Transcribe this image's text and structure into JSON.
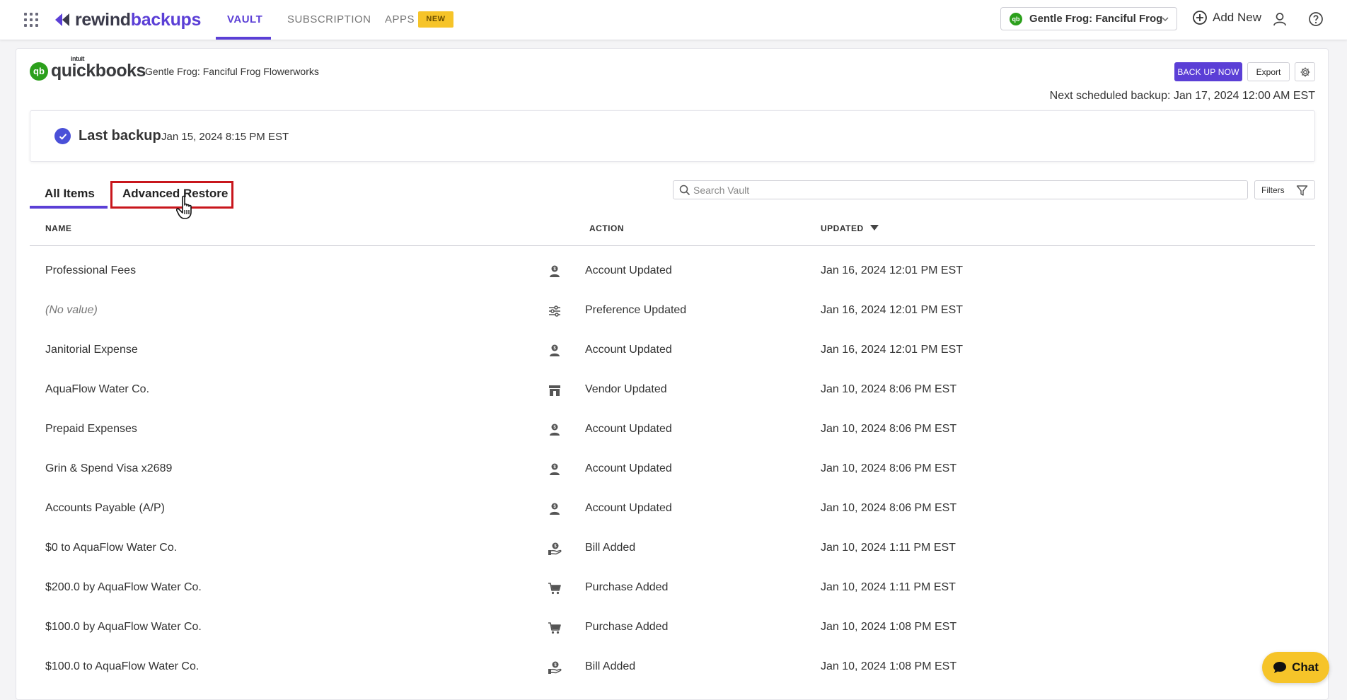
{
  "topbar": {
    "brand_part1": "rewind",
    "brand_part2": "backups",
    "nav": [
      {
        "label": "VAULT",
        "active": true
      },
      {
        "label": "SUBSCRIPTION",
        "active": false
      },
      {
        "label": "APPS",
        "active": false
      }
    ],
    "new_badge": "NEW",
    "org_selector": "Gentle Frog: Fanciful Frog F...",
    "add_new": "Add New",
    "icons": [
      "apps-grid-icon",
      "chevron-down-icon",
      "plus-circle-icon",
      "user-icon",
      "help-icon"
    ]
  },
  "header": {
    "logo_brand": "quickbooks",
    "logo_intuit": "intuit",
    "logo_mark": "qb",
    "company": "Gentle Frog: Fanciful Frog Flowerworks",
    "backup_button": "BACK UP NOW",
    "export_button": "Export",
    "next_backup": "Next scheduled backup: Jan 17, 2024 12:00 AM EST"
  },
  "last_backup": {
    "label": "Last backup",
    "date": "Jan 15, 2024 8:15 PM EST"
  },
  "tabs": {
    "all_items": "All Items",
    "advanced_restore": "Advanced Restore"
  },
  "search": {
    "placeholder": "Search Vault",
    "filters_label": "Filters"
  },
  "table": {
    "columns": {
      "name": "NAME",
      "action": "ACTION",
      "updated": "UPDATED"
    },
    "sort": "descending",
    "rows": [
      {
        "name": "Professional Fees",
        "icon": "account-icon",
        "action": "Account Updated",
        "updated": "Jan 16, 2024 12:01 PM EST"
      },
      {
        "name": "(No value)",
        "icon": "preference-icon",
        "action": "Preference Updated",
        "updated": "Jan 16, 2024 12:01 PM EST"
      },
      {
        "name": "Janitorial Expense",
        "icon": "account-icon",
        "action": "Account Updated",
        "updated": "Jan 16, 2024 12:01 PM EST"
      },
      {
        "name": "AquaFlow Water Co.",
        "icon": "vendor-icon",
        "action": "Vendor Updated",
        "updated": "Jan 10, 2024 8:06 PM EST"
      },
      {
        "name": "Prepaid Expenses",
        "icon": "account-icon",
        "action": "Account Updated",
        "updated": "Jan 10, 2024 8:06 PM EST"
      },
      {
        "name": "Grin & Spend Visa x2689",
        "icon": "account-icon",
        "action": "Account Updated",
        "updated": "Jan 10, 2024 8:06 PM EST"
      },
      {
        "name": "Accounts Payable (A/P)",
        "icon": "account-icon",
        "action": "Account Updated",
        "updated": "Jan 10, 2024 8:06 PM EST"
      },
      {
        "name": "$0 to AquaFlow Water Co.",
        "icon": "bill-icon",
        "action": "Bill Added",
        "updated": "Jan 10, 2024 1:11 PM EST"
      },
      {
        "name": "$200.0 by AquaFlow Water Co.",
        "icon": "cart-icon",
        "action": "Purchase Added",
        "updated": "Jan 10, 2024 1:11 PM EST"
      },
      {
        "name": "$100.0 by AquaFlow Water Co.",
        "icon": "cart-icon",
        "action": "Purchase Added",
        "updated": "Jan 10, 2024 1:08 PM EST"
      },
      {
        "name": "$100.0 to AquaFlow Water Co.",
        "icon": "bill-icon",
        "action": "Bill Added",
        "updated": "Jan 10, 2024 1:08 PM EST"
      }
    ]
  },
  "chat": {
    "label": "Chat"
  },
  "colors": {
    "accent": "#5b3fd6",
    "highlight": "#c8161c",
    "badge": "#f6c429",
    "quickbooks": "#2ca01c",
    "check": "#4a50d8"
  }
}
